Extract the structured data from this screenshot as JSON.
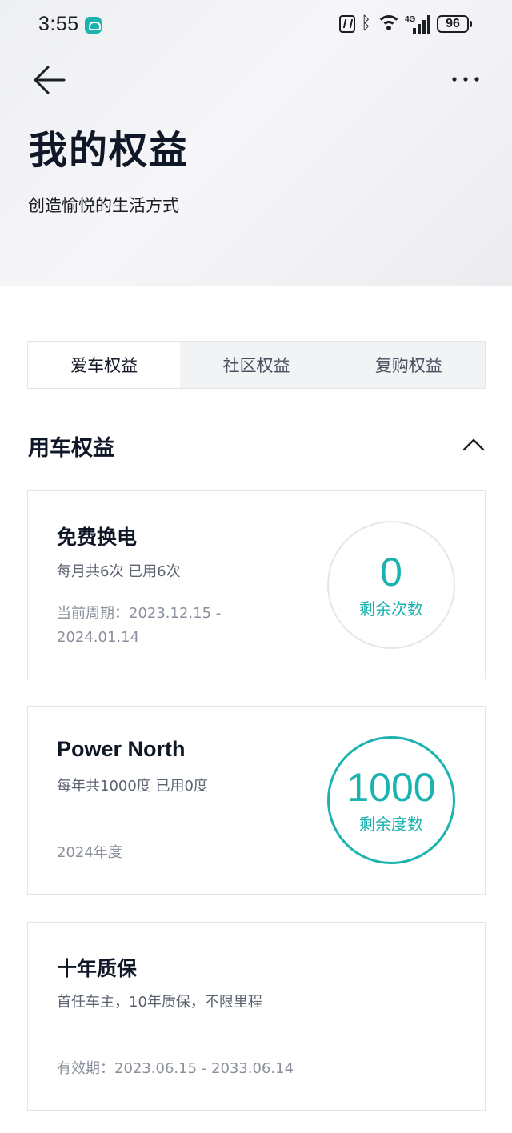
{
  "status_bar": {
    "time": "3:55",
    "signal_label": "4G",
    "battery": "96"
  },
  "header": {
    "title": "我的权益",
    "subtitle": "创造愉悦的生活方式"
  },
  "tabs": [
    {
      "label": "爱车权益",
      "active": true
    },
    {
      "label": "社区权益",
      "active": false
    },
    {
      "label": "复购权益",
      "active": false
    }
  ],
  "section": {
    "title": "用车权益"
  },
  "cards": [
    {
      "title": "免费换电",
      "desc": "每月共6次 已用6次",
      "meta": "当前周期：2023.12.15 - 2024.01.14",
      "value": "0",
      "value_label": "剩余次数"
    },
    {
      "title": "Power North",
      "desc": "每年共1000度 已用0度",
      "meta": "2024年度",
      "value": "1000",
      "value_label": "剩余度数"
    },
    {
      "title": "十年质保",
      "desc": "首任车主，10年质保，不限里程",
      "meta": "有效期：2023.06.15 - 2033.06.14"
    }
  ],
  "colors": {
    "accent": "#1bb3b0",
    "title": "#101828",
    "muted": "#8a909b"
  },
  "icons": {
    "back": "arrow-left-icon",
    "more": "more-dots-icon",
    "collapse": "chevron-up-icon"
  }
}
